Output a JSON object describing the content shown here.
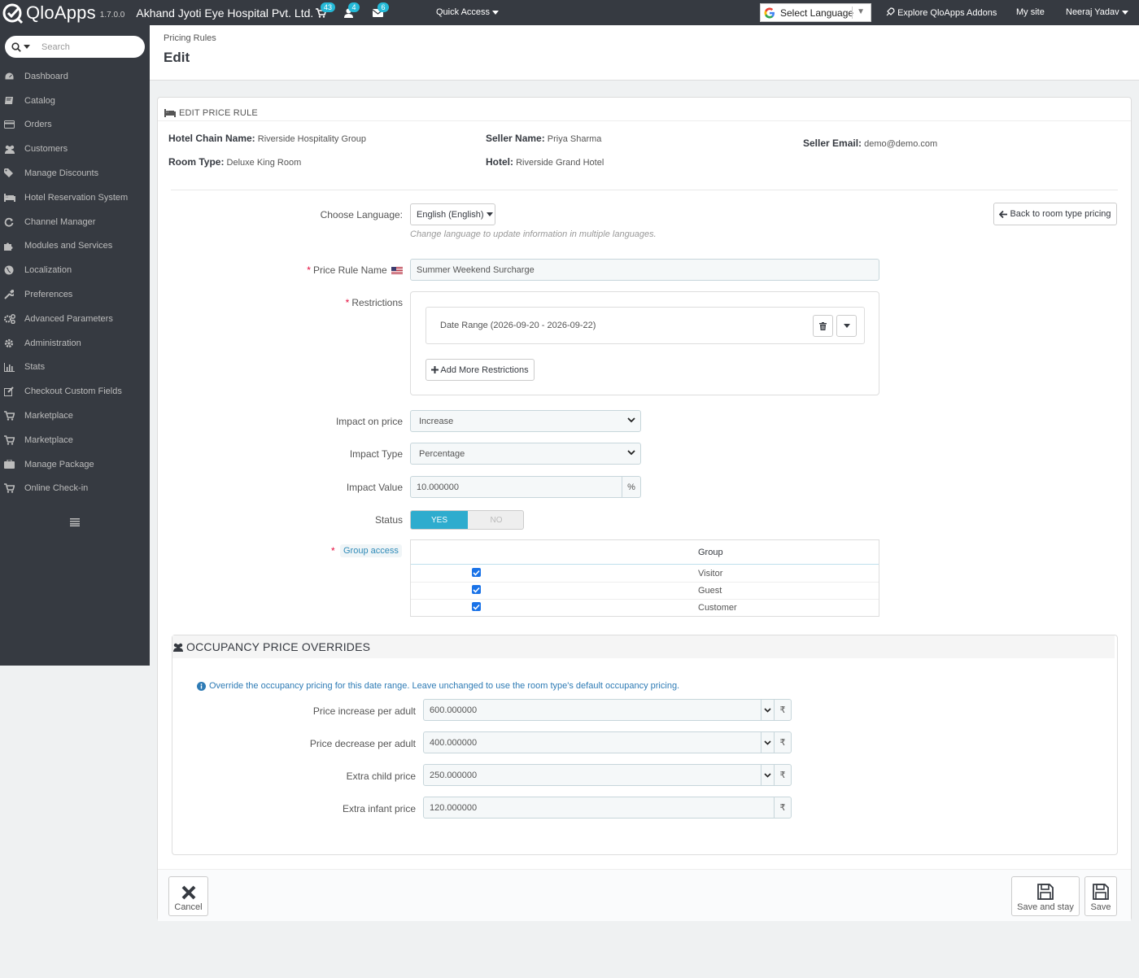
{
  "topbar": {
    "brand": "QloApps",
    "version": "1.7.0.0",
    "shop_name": "Akhand Jyoti Eye Hospital Pvt. Ltd.",
    "notifications": {
      "orders": "43",
      "customers": "4",
      "messages": "6"
    },
    "quick_access": "Quick Access",
    "language": "Select Language",
    "explore": "Explore QloApps Addons",
    "my_site": "My site",
    "user": "Neeraj Yadav"
  },
  "sidebar": {
    "search_placeholder": "Search",
    "items": [
      {
        "label": "Dashboard",
        "icon": "dashboard-icon"
      },
      {
        "label": "Catalog",
        "icon": "book-icon"
      },
      {
        "label": "Orders",
        "icon": "credit-card-icon"
      },
      {
        "label": "Customers",
        "icon": "users-icon"
      },
      {
        "label": "Manage Discounts",
        "icon": "tags-icon"
      },
      {
        "label": "Hotel Reservation System",
        "icon": "bed-icon"
      },
      {
        "label": "Channel Manager",
        "icon": "refresh-icon"
      },
      {
        "label": "Modules and Services",
        "icon": "puzzle-icon"
      },
      {
        "label": "Localization",
        "icon": "globe-icon"
      },
      {
        "label": "Preferences",
        "icon": "wrench-icon"
      },
      {
        "label": "Advanced Parameters",
        "icon": "cogs-icon"
      },
      {
        "label": "Administration",
        "icon": "cog-icon"
      },
      {
        "label": "Stats",
        "icon": "bar-chart-icon"
      },
      {
        "label": "Checkout Custom Fields",
        "icon": "edit-icon"
      },
      {
        "label": "Marketplace",
        "icon": "cart-icon"
      },
      {
        "label": "Marketplace",
        "icon": "cart-icon"
      },
      {
        "label": "Manage Package",
        "icon": "briefcase-icon"
      },
      {
        "label": "Online Check-in",
        "icon": "cart-icon"
      }
    ]
  },
  "header": {
    "breadcrumb": "Pricing Rules",
    "title": "Edit"
  },
  "panel": {
    "heading": "EDIT PRICE RULE",
    "info": {
      "hotel_chain_label": "Hotel Chain Name:",
      "hotel_chain_value": "Riverside Hospitality Group",
      "seller_name_label": "Seller Name:",
      "seller_name_value": "Priya Sharma",
      "seller_email_label": "Seller Email:",
      "seller_email_value": "demo@demo.com",
      "room_type_label": "Room Type:",
      "room_type_value": "Deluxe King Room",
      "hotel_label": "Hotel:",
      "hotel_value": "Riverside Grand Hotel"
    },
    "choose_language_label": "Choose Language:",
    "language_value": "English (English)",
    "language_help": "Change language to update information in multiple languages.",
    "back_button": "Back to room type pricing",
    "price_rule_name_label": "Price Rule Name",
    "price_rule_name_value": "Summer Weekend Surcharge",
    "restrictions_label": "Restrictions",
    "restriction_item": "Date Range (2026-09-20 - 2026-09-22)",
    "add_restrictions": "Add More Restrictions",
    "impact_price_label": "Impact on price",
    "impact_price_value": "Increase",
    "impact_type_label": "Impact Type",
    "impact_type_value": "Percentage",
    "impact_value_label": "Impact Value",
    "impact_value_value": "10.000000",
    "impact_value_addon": "%",
    "status_label": "Status",
    "status_yes": "YES",
    "status_no": "NO",
    "group_access_label": "Group access",
    "group_header": "Group",
    "groups": [
      "Visitor",
      "Guest",
      "Customer"
    ]
  },
  "occupancy": {
    "heading": "OCCUPANCY PRICE OVERRIDES",
    "info": "Override the occupancy pricing for this date range. Leave unchanged to use the room type's default occupancy pricing.",
    "currency": "₹",
    "rows": [
      {
        "label": "Price increase per adult",
        "value": "600.000000"
      },
      {
        "label": "Price decrease per adult",
        "value": "400.000000"
      },
      {
        "label": "Extra child price",
        "value": "250.000000"
      },
      {
        "label": "Extra infant price",
        "value": "120.000000"
      }
    ]
  },
  "footer": {
    "cancel": "Cancel",
    "save_stay": "Save and stay",
    "save": "Save"
  },
  "colors": {
    "sidebar_bg": "#363a41",
    "accent": "#25b9d7",
    "switch_on": "#2eacce",
    "required": "#e50b3c"
  }
}
